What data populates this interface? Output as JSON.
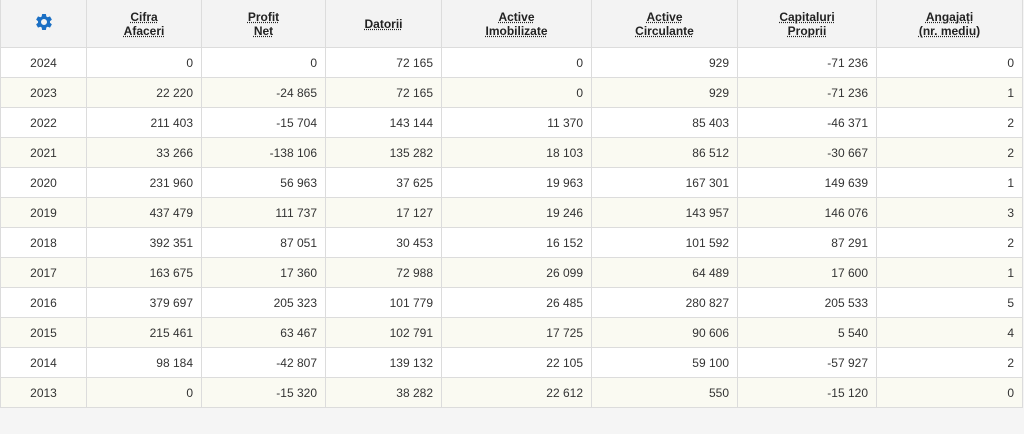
{
  "toolbar": {
    "settings_icon": "gear-icon",
    "accent_color": "#1a6fc4"
  },
  "columns": [
    {
      "line1": "Cifra",
      "line2": "Afaceri"
    },
    {
      "line1": "Profit",
      "line2": "Net"
    },
    {
      "line1": "Datorii",
      "line2": ""
    },
    {
      "line1": "Active",
      "line2": "Imobilizate"
    },
    {
      "line1": "Active",
      "line2": "Circulante"
    },
    {
      "line1": "Capitaluri",
      "line2": "Proprii"
    },
    {
      "line1": "Angajați",
      "line2": "(nr. mediu)"
    }
  ],
  "rows": [
    {
      "year": "2024",
      "cells": [
        "0",
        "0",
        "72 165",
        "0",
        "929",
        "-71 236",
        "0"
      ]
    },
    {
      "year": "2023",
      "cells": [
        "22 220",
        "-24 865",
        "72 165",
        "0",
        "929",
        "-71 236",
        "1"
      ]
    },
    {
      "year": "2022",
      "cells": [
        "211 403",
        "-15 704",
        "143 144",
        "11 370",
        "85 403",
        "-46 371",
        "2"
      ]
    },
    {
      "year": "2021",
      "cells": [
        "33 266",
        "-138 106",
        "135 282",
        "18 103",
        "86 512",
        "-30 667",
        "2"
      ]
    },
    {
      "year": "2020",
      "cells": [
        "231 960",
        "56 963",
        "37 625",
        "19 963",
        "167 301",
        "149 639",
        "1"
      ]
    },
    {
      "year": "2019",
      "cells": [
        "437 479",
        "111 737",
        "17 127",
        "19 246",
        "143 957",
        "146 076",
        "3"
      ]
    },
    {
      "year": "2018",
      "cells": [
        "392 351",
        "87 051",
        "30 453",
        "16 152",
        "101 592",
        "87 291",
        "2"
      ]
    },
    {
      "year": "2017",
      "cells": [
        "163 675",
        "17 360",
        "72 988",
        "26 099",
        "64 489",
        "17 600",
        "1"
      ]
    },
    {
      "year": "2016",
      "cells": [
        "379 697",
        "205 323",
        "101 779",
        "26 485",
        "280 827",
        "205 533",
        "5"
      ]
    },
    {
      "year": "2015",
      "cells": [
        "215 461",
        "63 467",
        "102 791",
        "17 725",
        "90 606",
        "5 540",
        "4"
      ]
    },
    {
      "year": "2014",
      "cells": [
        "98 184",
        "-42 807",
        "139 132",
        "22 105",
        "59 100",
        "-57 927",
        "2"
      ]
    },
    {
      "year": "2013",
      "cells": [
        "0",
        "-15 320",
        "38 282",
        "22 612",
        "550",
        "-15 120",
        "0"
      ]
    }
  ]
}
